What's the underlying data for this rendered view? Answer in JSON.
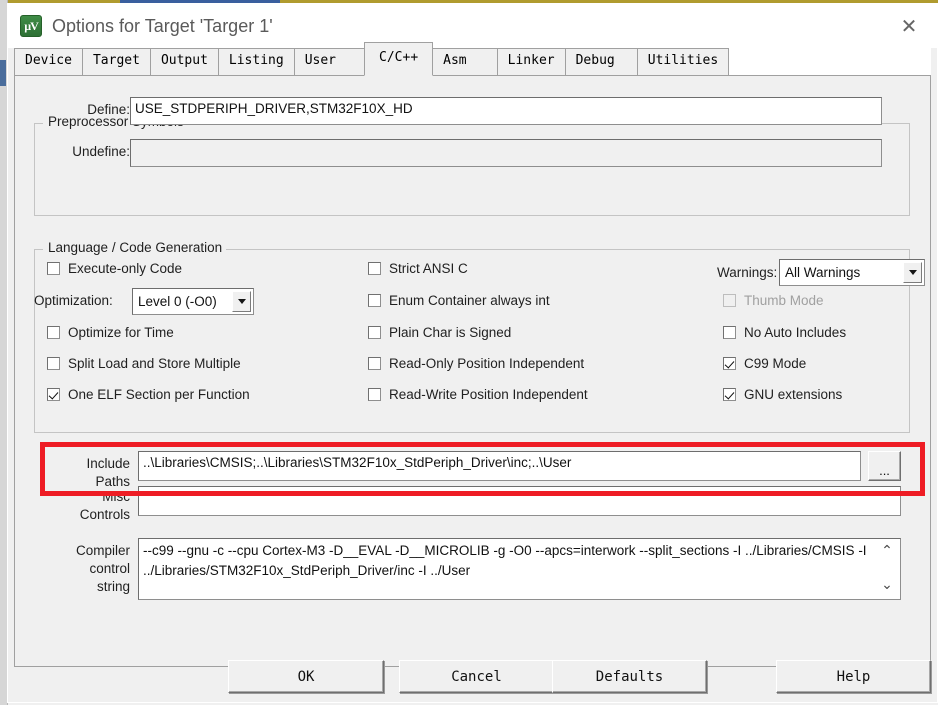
{
  "window": {
    "title": "Options for Target 'Targer 1'",
    "icon": "keil-uvision-icon",
    "close_label": "✕"
  },
  "tabs": [
    {
      "label": "Device",
      "active": false
    },
    {
      "label": "Target",
      "active": false
    },
    {
      "label": "Output",
      "active": false
    },
    {
      "label": "Listing",
      "active": false
    },
    {
      "label": "User",
      "active": false
    },
    {
      "label": "C/C++",
      "active": true
    },
    {
      "label": "Asm",
      "active": false
    },
    {
      "label": "Linker",
      "active": false
    },
    {
      "label": "Debug",
      "active": false
    },
    {
      "label": "Utilities",
      "active": false
    }
  ],
  "preprocessor": {
    "group_title": "Preprocessor Symbols",
    "define_label": "Define:",
    "define_value": "USE_STDPERIPH_DRIVER,STM32F10X_HD",
    "undefine_label": "Undefine:",
    "undefine_value": ""
  },
  "language": {
    "group_title": "Language / Code Generation",
    "col1": [
      {
        "label": "Execute-only Code",
        "checked": false,
        "disabled": false
      },
      {
        "label": "Optimize for Time",
        "checked": false,
        "disabled": false
      },
      {
        "label": "Split Load and Store Multiple",
        "checked": false,
        "disabled": false
      },
      {
        "label": "One ELF Section per Function",
        "checked": true,
        "disabled": false
      }
    ],
    "col2": [
      {
        "label": "Strict ANSI C",
        "checked": false,
        "disabled": false
      },
      {
        "label": "Enum Container always int",
        "checked": false,
        "disabled": false
      },
      {
        "label": "Plain Char is Signed",
        "checked": false,
        "disabled": false
      },
      {
        "label": "Read-Only Position Independent",
        "checked": false,
        "disabled": false
      },
      {
        "label": "Read-Write Position Independent",
        "checked": false,
        "disabled": false
      }
    ],
    "col3": [
      {
        "label": "Thumb Mode",
        "checked": false,
        "disabled": true
      },
      {
        "label": "No Auto Includes",
        "checked": false,
        "disabled": false
      },
      {
        "label": "C99 Mode",
        "checked": true,
        "disabled": false
      },
      {
        "label": "GNU extensions",
        "checked": true,
        "disabled": false
      }
    ],
    "optimization_label": "Optimization:",
    "optimization_value": "Level 0 (-O0)",
    "warnings_label": "Warnings:",
    "warnings_value": "All Warnings"
  },
  "paths": {
    "include_label_line1": "Include",
    "include_label_line2": "Paths",
    "include_value": "..\\Libraries\\CMSIS;..\\Libraries\\STM32F10x_StdPeriph_Driver\\inc;..\\User",
    "browse_label": "...",
    "misc_label_line1": "Misc",
    "misc_label_line2": "Controls",
    "misc_value": "",
    "compiler_label_line1": "Compiler",
    "compiler_label_line2": "control",
    "compiler_label_line3": "string",
    "compiler_value": "--c99 --gnu -c --cpu Cortex-M3 -D__EVAL -D__MICROLIB -g -O0 --apcs=interwork --split_sections -I ../Libraries/CMSIS -I ../Libraries/STM32F10x_StdPeriph_Driver/inc -I ../User",
    "scroll_up_icon": "⌃",
    "scroll_down_icon": "⌄"
  },
  "buttons": [
    {
      "label": "OK"
    },
    {
      "label": "Cancel"
    },
    {
      "label": "Defaults"
    },
    {
      "label": "Help"
    }
  ],
  "annotation": {
    "color": "#ee1c24",
    "target": "include-paths-row"
  }
}
